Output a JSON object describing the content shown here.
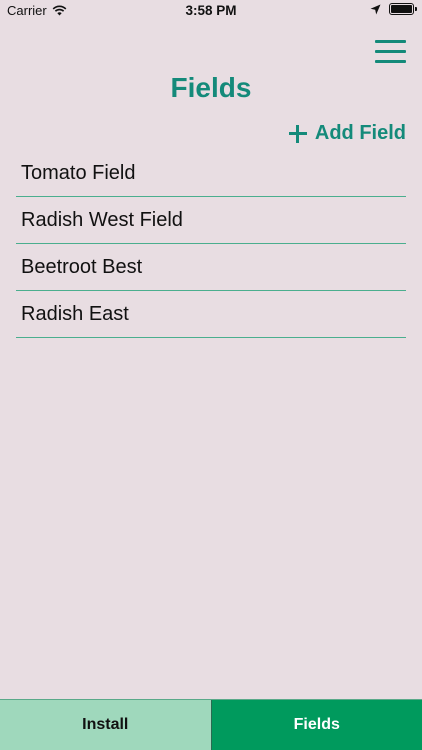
{
  "status_bar": {
    "carrier": "Carrier",
    "time": "3:58 PM"
  },
  "header": {
    "title": "Fields",
    "add_label": "Add Field"
  },
  "fields": [
    {
      "name": "Tomato Field"
    },
    {
      "name": "Radish West Field"
    },
    {
      "name": "Beetroot Best"
    },
    {
      "name": "Radish East"
    }
  ],
  "tabs": [
    {
      "label": "Install",
      "active": false
    },
    {
      "label": "Fields",
      "active": true
    }
  ],
  "colors": {
    "accent": "#148a7a",
    "background": "#e8dde2",
    "divider": "#4aae8e",
    "tab_inactive": "#9fd8bc",
    "tab_active": "#009a5d"
  }
}
